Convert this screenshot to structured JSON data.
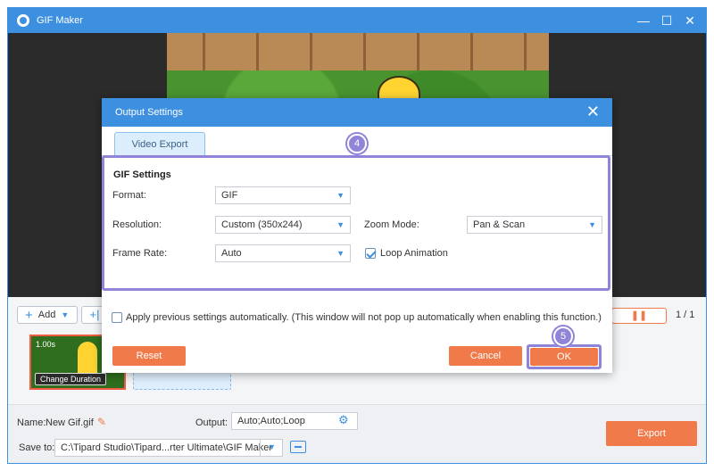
{
  "app": {
    "title": "GIF Maker"
  },
  "window_controls": {
    "minimize": "—",
    "maximize": "☐",
    "close": "✕"
  },
  "toolbar": {
    "add_label": "Add",
    "add2_label": "+|",
    "pause_symbol": "❚❚",
    "page_count": "1 / 1"
  },
  "clip": {
    "duration": "1.00s",
    "change_duration_label": "Change Duration"
  },
  "bottom_bar": {
    "name_label": "Name:",
    "name_value": "New Gif.gif",
    "output_label": "Output:",
    "output_value": "Auto;Auto;Loop",
    "save_to_label": "Save to:",
    "save_to_value": "C:\\Tipard Studio\\Tipard...rter Ultimate\\GIF Maker",
    "export_label": "Export"
  },
  "dialog": {
    "title": "Output Settings",
    "tab_label": "Video Export",
    "section_title": "GIF Settings",
    "format_label": "Format:",
    "format_value": "GIF",
    "resolution_label": "Resolution:",
    "resolution_value": "Custom (350x244)",
    "zoom_mode_label": "Zoom Mode:",
    "zoom_mode_value": "Pan & Scan",
    "frame_rate_label": "Frame Rate:",
    "frame_rate_value": "Auto",
    "loop_animation_label": "Loop Animation",
    "loop_animation_checked": true,
    "apply_previous_label": "Apply previous settings automatically. (This window will not pop up automatically when enabling this function.)",
    "apply_previous_checked": false,
    "reset_label": "Reset",
    "cancel_label": "Cancel",
    "ok_label": "OK"
  },
  "annotations": {
    "badge_settings": "4",
    "badge_ok": "5"
  },
  "colors": {
    "accent": "#3d8fe0",
    "action": "#f07a4a",
    "annotation": "#8f84d8"
  },
  "icons": [
    "app-logo-icon",
    "minimize-icon",
    "maximize-icon",
    "close-icon",
    "plus-icon",
    "chevron-down-icon",
    "pause-icon",
    "pencil-icon",
    "gear-icon",
    "folder-icon",
    "checkmark-icon"
  ]
}
